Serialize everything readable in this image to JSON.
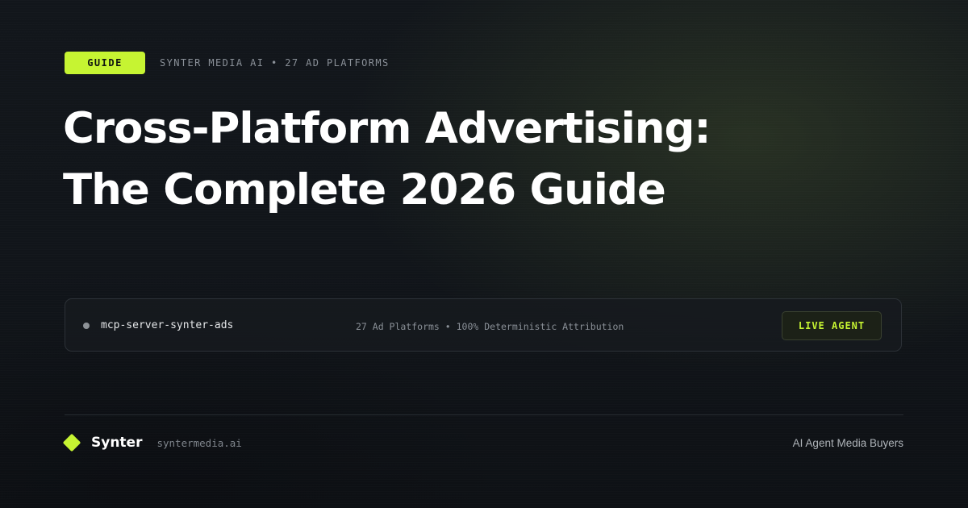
{
  "header": {
    "badge": "GUIDE",
    "meta": "SYNTER MEDIA AI • 27 AD PLATFORMS"
  },
  "title": {
    "line1": "Cross-Platform Advertising:",
    "line2": "The Complete 2026 Guide"
  },
  "agent_panel": {
    "server_name": "mcp-server-synter-ads",
    "info": "27 Ad Platforms • 100% Deterministic Attribution",
    "button_label": "LIVE AGENT",
    "status_color": "#8d9297"
  },
  "footer": {
    "brand": "Synter",
    "domain": "syntermedia.ai",
    "tagline": "AI Agent Media Buyers",
    "logo_icon": "diamond-icon"
  },
  "colors": {
    "accent": "#c6f432",
    "background": "#0f1216"
  }
}
